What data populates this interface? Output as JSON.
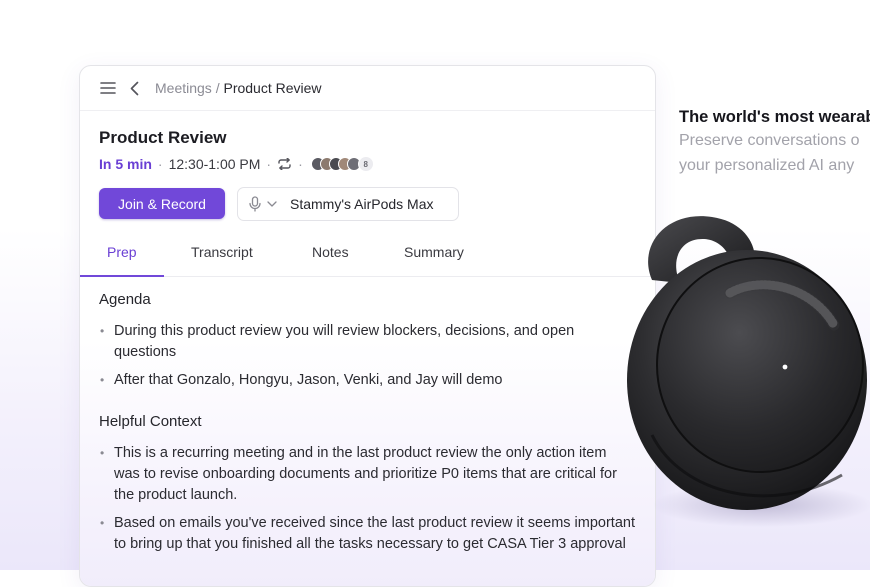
{
  "breadcrumb": {
    "parent": "Meetings",
    "separator": "/",
    "current": "Product Review"
  },
  "meeting": {
    "title": "Product Review",
    "starts_in": "In 5 min",
    "time": "12:30-1:00 PM",
    "separator": "·",
    "more_attendees": "8"
  },
  "actions": {
    "join_label": "Join & Record",
    "audio_device": "Stammy's AirPods Max"
  },
  "tabs": [
    {
      "label": "Prep",
      "active": true
    },
    {
      "label": "Transcript",
      "active": false
    },
    {
      "label": "Notes",
      "active": false
    },
    {
      "label": "Summary",
      "active": false
    }
  ],
  "prep": {
    "agenda_heading": "Agenda",
    "agenda_items": [
      "During this product review you will review blockers, decisions, and open questions",
      "After that Gonzalo, Hongyu, Jason, Venki, and Jay will demo"
    ],
    "context_heading": "Helpful Context",
    "context_items": [
      "This is a recurring meeting and in the last product review the only action item was to revise onboarding documents and prioritize P0 items that are critical for the product launch.",
      "Based on emails you've received since the last product review it seems important to bring up that you finished all the tasks necessary to get CASA Tier 3 approval"
    ]
  },
  "promo": {
    "title": "The world's most wearab",
    "subtitle_line1": "Preserve conversations o",
    "subtitle_line2": "your personalized AI any"
  },
  "colors": {
    "accent": "#7148d9",
    "accent_text": "#6a3fd4",
    "muted": "#8b8b94"
  },
  "icons": [
    "menu-icon",
    "chevron-left-icon",
    "repeat-icon",
    "microphone-icon",
    "chevron-down-icon"
  ]
}
